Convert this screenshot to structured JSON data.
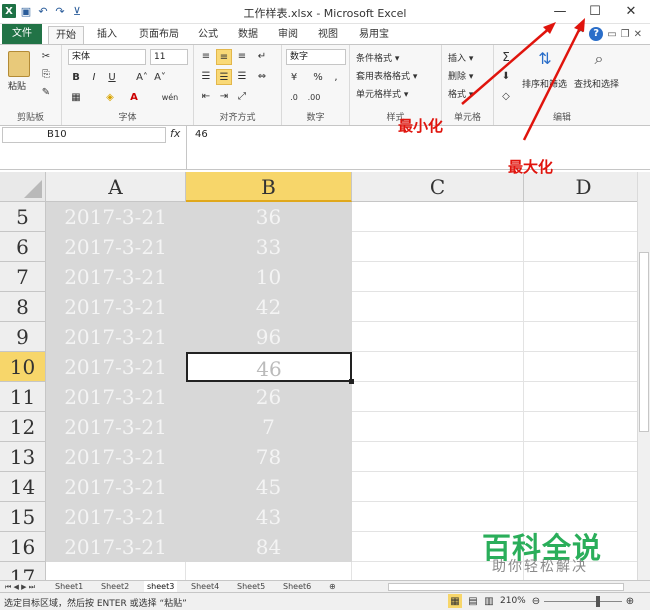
{
  "window": {
    "title": "工作样表.xlsx - Microsoft Excel",
    "minimize_glyph": "—",
    "maximize_glyph": "☐",
    "close_glyph": "✕"
  },
  "quick_access": {
    "excel_icon": "X",
    "save_icon": "▣",
    "undo_icon": "↶",
    "redo_icon": "↷",
    "customize_icon": "⊻"
  },
  "tabs": [
    "文件",
    "开始",
    "插入",
    "页面布局",
    "公式",
    "数据",
    "审阅",
    "视图",
    "易用宝"
  ],
  "tab_right": {
    "help_icon": "?",
    "min": "▭",
    "restore": "❐",
    "close": "✕",
    "collapse": "⌃"
  },
  "ribbon": {
    "clipboard": {
      "paste": "粘贴",
      "label": "剪贴板"
    },
    "font": {
      "name": "宋体",
      "size": "11",
      "bold": "B",
      "italic": "I",
      "underline": "U",
      "grow": "A˄",
      "shrink": "A˅",
      "fill_icon": "◈",
      "font_color": "A",
      "wen": "wén",
      "label": "字体"
    },
    "alignment": {
      "label": "对齐方式"
    },
    "number": {
      "format": "数字",
      "pct": "%",
      "comma": ",",
      "label": "数字"
    },
    "styles": {
      "cond": "条件格式 ▾",
      "table": "套用表格格式 ▾",
      "cell": "单元格样式 ▾",
      "label": "样式"
    },
    "cells": {
      "insert": "插入 ▾",
      "delete": "删除 ▾",
      "format": "格式 ▾",
      "label": "单元格"
    },
    "editing": {
      "sum": "Σ",
      "sort": "排序和筛选",
      "find": "查找和选择",
      "label": "编辑"
    }
  },
  "formula_bar": {
    "name_box": "B10",
    "fx": "fx",
    "value": "46"
  },
  "columns": [
    "A",
    "B",
    "C",
    "D"
  ],
  "rows": [
    {
      "num": "5",
      "a": "2017-3-21",
      "b": "36"
    },
    {
      "num": "6",
      "a": "2017-3-21",
      "b": "33"
    },
    {
      "num": "7",
      "a": "2017-3-21",
      "b": "10"
    },
    {
      "num": "8",
      "a": "2017-3-21",
      "b": "42"
    },
    {
      "num": "9",
      "a": "2017-3-21",
      "b": "96"
    },
    {
      "num": "10",
      "a": "2017-3-21",
      "b": "46"
    },
    {
      "num": "11",
      "a": "2017-3-21",
      "b": "26"
    },
    {
      "num": "12",
      "a": "2017-3-21",
      "b": "7"
    },
    {
      "num": "13",
      "a": "2017-3-21",
      "b": "78"
    },
    {
      "num": "14",
      "a": "2017-3-21",
      "b": "45"
    },
    {
      "num": "15",
      "a": "2017-3-21",
      "b": "43"
    },
    {
      "num": "16",
      "a": "2017-3-21",
      "b": "84"
    },
    {
      "num": "17",
      "a": "",
      "b": ""
    }
  ],
  "sheet_tabs": [
    "Sheet1",
    "Sheet2",
    "sheet3",
    "Sheet4",
    "Sheet5",
    "Sheet6"
  ],
  "status": {
    "message": "选定目标区域，然后按 ENTER 或选择 “粘贴”",
    "zoom": "210%"
  },
  "annotations": {
    "minimize": "最小化",
    "maximize": "最大化",
    "color": "#e0140d"
  },
  "watermark": {
    "title": "百科全说",
    "subtitle": "助你轻松解决"
  }
}
